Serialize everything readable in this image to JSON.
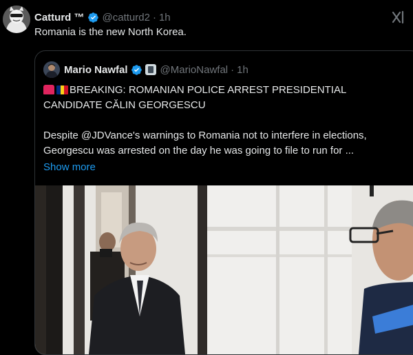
{
  "tweet": {
    "author_name": "Catturd ™",
    "handle": "@catturd2",
    "separator": "·",
    "time": "1h",
    "text": "Romania is the new North Korea."
  },
  "quote": {
    "author_name": "Mario Nawfal",
    "handle": "@MarioNawfal",
    "separator": "·",
    "time": "1h",
    "headline_1": "BREAKING: ROMANIAN POLICE ARREST PRESIDENTIAL",
    "headline_2": "CANDIDATE CĂLIN GEORGESCU",
    "body_1": "Despite @JDVance's warnings to Romania not to interfere in elections,",
    "body_2": "Georgescu was arrested on the day he was going to file to run for ...",
    "show_more": "Show more",
    "emoji": [
      "police-light",
      "romania-flag"
    ]
  },
  "icons": [
    "verified-badge-icon",
    "grok-icon",
    "affiliate-badge-icon",
    "siren-icon",
    "romania-flag-icon"
  ],
  "colors": {
    "background": "#000000",
    "text": "#e7e9ea",
    "muted": "#71767b",
    "link": "#1d9bf0",
    "verified": "#1d9bf0",
    "border": "#2f3336"
  }
}
